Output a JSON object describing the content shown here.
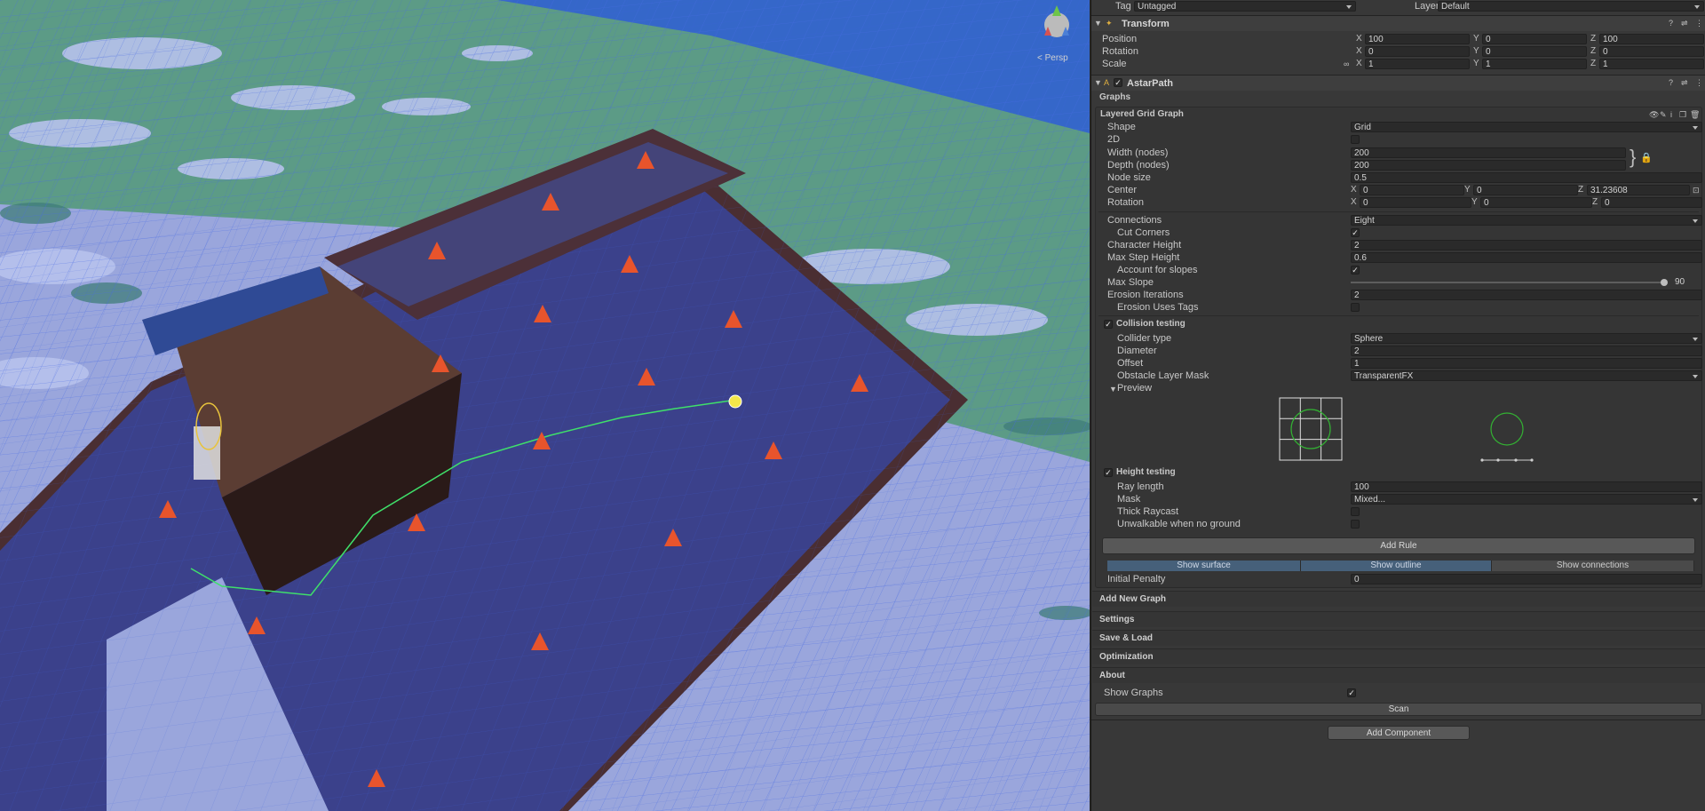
{
  "scene": {
    "gizmo_label": "< Persp"
  },
  "inspector": {
    "top": {
      "tag_label": "Tag",
      "tag_value": "Untagged",
      "layer_label": "Layer",
      "layer_value": "Default"
    },
    "transform": {
      "title": "Transform",
      "position": {
        "label": "Position",
        "x": "100",
        "y": "0",
        "z": "100"
      },
      "rotation": {
        "label": "Rotation",
        "x": "0",
        "y": "0",
        "z": "0"
      },
      "scale": {
        "label": "Scale",
        "x": "1",
        "y": "1",
        "z": "1"
      }
    },
    "astar": {
      "title": "AstarPath",
      "graphs_label": "Graphs",
      "graph_name": "Layered Grid Graph",
      "shape": {
        "label": "Shape",
        "value": "Grid"
      },
      "two_d": {
        "label": "2D"
      },
      "width": {
        "label": "Width (nodes)",
        "value": "200"
      },
      "depth": {
        "label": "Depth (nodes)",
        "value": "200"
      },
      "node_size": {
        "label": "Node size",
        "value": "0.5"
      },
      "center": {
        "label": "Center",
        "x": "0",
        "y": "0",
        "z": "31.23608"
      },
      "rotation": {
        "label": "Rotation",
        "x": "0",
        "y": "0",
        "z": "0"
      },
      "connections": {
        "label": "Connections",
        "value": "Eight"
      },
      "cut_corners": {
        "label": "Cut Corners",
        "checked": "✓"
      },
      "character_height": {
        "label": "Character Height",
        "value": "2"
      },
      "max_step_height": {
        "label": "Max Step Height",
        "value": "0.6"
      },
      "account_slopes": {
        "label": "Account for slopes",
        "checked": "✓"
      },
      "max_slope": {
        "label": "Max Slope",
        "value": "90"
      },
      "erosion_iterations": {
        "label": "Erosion Iterations",
        "value": "2"
      },
      "erosion_tags": {
        "label": "Erosion Uses Tags"
      },
      "collision": {
        "label": "Collision testing",
        "checked": "✓"
      },
      "collider_type": {
        "label": "Collider type",
        "value": "Sphere"
      },
      "diameter": {
        "label": "Diameter",
        "value": "2"
      },
      "offset": {
        "label": "Offset",
        "value": "1"
      },
      "obstacle_mask": {
        "label": "Obstacle Layer Mask",
        "value": "TransparentFX"
      },
      "preview_label": "Preview",
      "height": {
        "label": "Height testing",
        "checked": "✓"
      },
      "ray_length": {
        "label": "Ray length",
        "value": "100"
      },
      "mask": {
        "label": "Mask",
        "value": "Mixed..."
      },
      "thick_raycast": {
        "label": "Thick Raycast"
      },
      "unwalkable": {
        "label": "Unwalkable when no ground"
      },
      "add_rule": "Add Rule",
      "show_surface": "Show surface",
      "show_outline": "Show outline",
      "show_connections": "Show connections",
      "initial_penalty": {
        "label": "Initial Penalty",
        "value": "0"
      },
      "add_new_graph": "Add New Graph",
      "settings": "Settings",
      "save_load": "Save & Load",
      "optimization": "Optimization",
      "about": "About",
      "show_graphs": {
        "label": "Show Graphs",
        "checked": "✓"
      },
      "scan": "Scan"
    },
    "add_component": "Add Component"
  },
  "colors": {
    "accent_tab": "#46607a",
    "cone": "#e8542c",
    "ground_overlay": "#2f52d6",
    "wood": "#5a3a33"
  }
}
